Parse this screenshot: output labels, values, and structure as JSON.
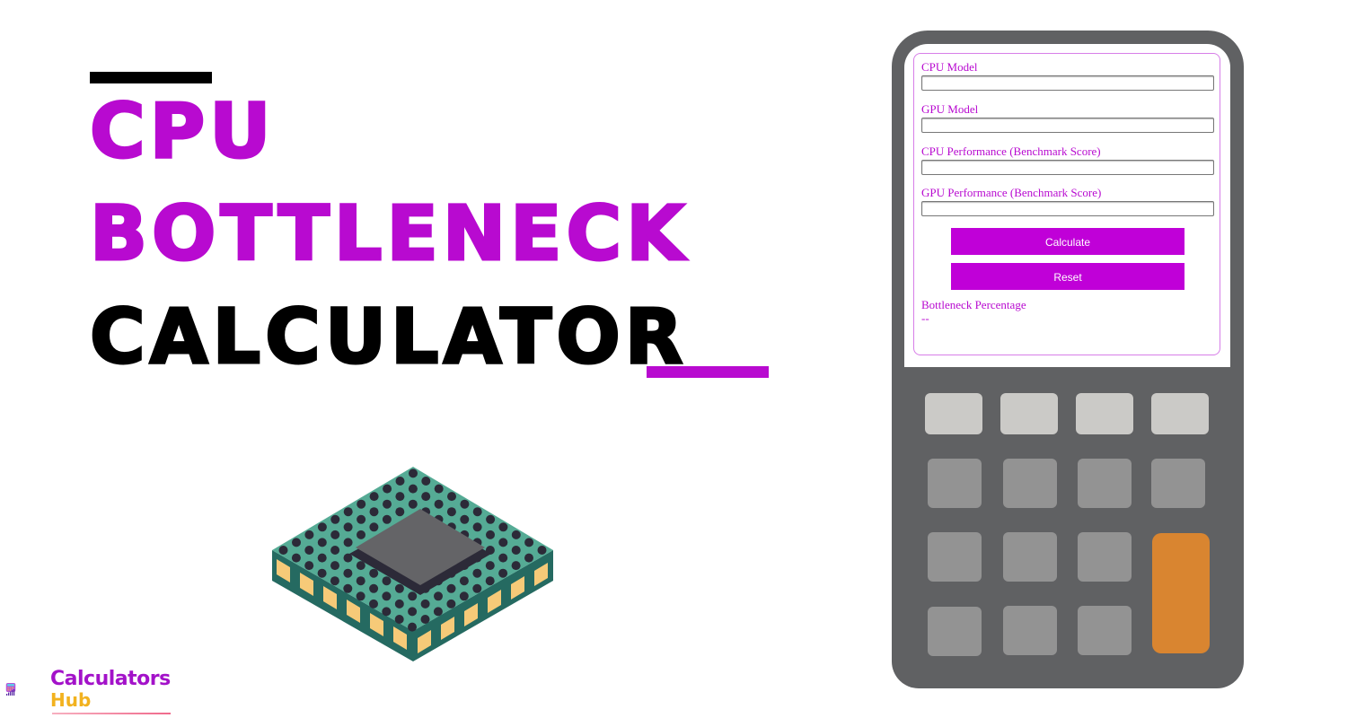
{
  "title": {
    "line1": "CPU",
    "line2": "BOTTLENECK",
    "line3": "CALCULATOR",
    "accent_color": "#b80ad0",
    "dark_color": "#000000"
  },
  "calculator": {
    "fields": [
      {
        "label": "CPU Model",
        "value": "",
        "placeholder": ""
      },
      {
        "label": "GPU Model",
        "value": "",
        "placeholder": ""
      },
      {
        "label": "CPU Performance (Benchmark Score)",
        "value": "",
        "placeholder": ""
      },
      {
        "label": "GPU Performance (Benchmark Score)",
        "value": "",
        "placeholder": ""
      }
    ],
    "calculate_label": "Calculate",
    "reset_label": "Reset",
    "result_label": "Bottleneck Percentage",
    "result_value": "--",
    "button_color": "#c000d8"
  },
  "logo": {
    "line1": "Calculators",
    "line2": "Hub"
  },
  "illustration": {
    "chip_icon": "cpu-chip-icon",
    "keypad_icon": "calculator-keypad-icon"
  }
}
